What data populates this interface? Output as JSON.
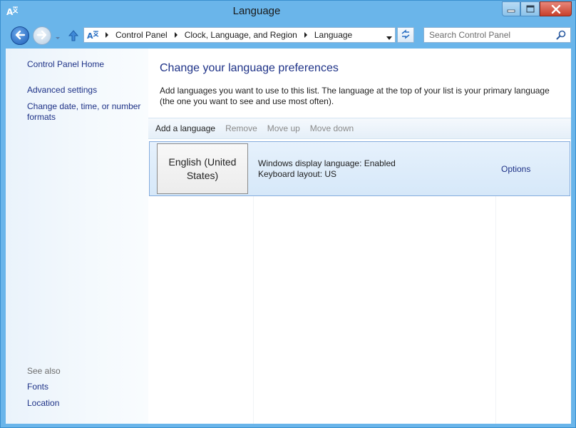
{
  "window": {
    "title": "Language"
  },
  "address": {
    "crumbs": [
      "Control Panel",
      "Clock, Language, and Region",
      "Language"
    ]
  },
  "search": {
    "placeholder": "Search Control Panel"
  },
  "sidebar": {
    "links": [
      "Control Panel Home",
      "Advanced settings",
      "Change date, time, or number formats"
    ],
    "see_also_label": "See also",
    "see_also": [
      "Fonts",
      "Location"
    ]
  },
  "main": {
    "heading": "Change your language preferences",
    "description": "Add languages you want to use to this list. The language at the top of your list is your primary language (the one you want to see and use most often).",
    "toolbar": {
      "add": "Add a language",
      "remove": "Remove",
      "move_up": "Move up",
      "move_down": "Move down"
    },
    "languages": [
      {
        "name": "English (United States)",
        "display_status": "Windows display language: Enabled",
        "keyboard": "Keyboard layout: US",
        "options_label": "Options"
      }
    ]
  },
  "colors": {
    "frame": "#6ab5ea",
    "link": "#1e3287",
    "selected_row": "#d6e8f9"
  },
  "icons": [
    "language-app-icon",
    "minimize-icon",
    "maximize-icon",
    "close-icon",
    "back-arrow-icon",
    "forward-arrow-icon",
    "recent-pages-chevron-icon",
    "up-arrow-icon",
    "breadcrumb-chevron-icon",
    "address-dropdown-icon",
    "refresh-icon",
    "search-icon"
  ]
}
